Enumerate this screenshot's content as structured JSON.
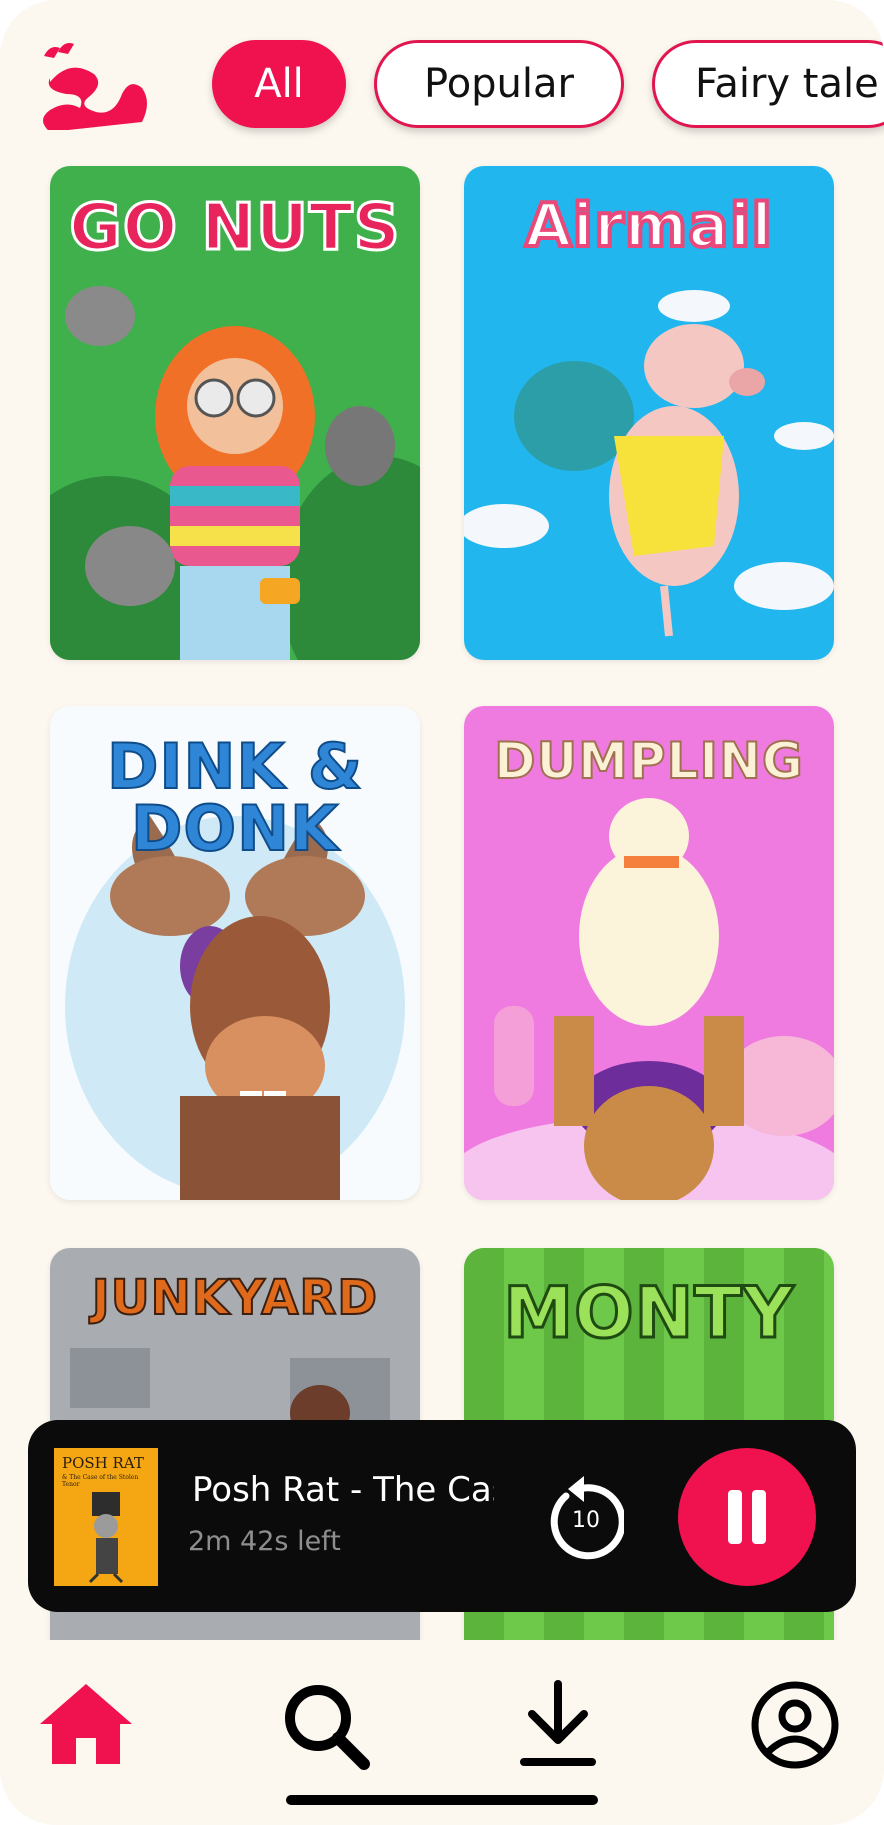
{
  "filters": [
    {
      "label": "All",
      "selected": true
    },
    {
      "label": "Popular",
      "selected": false
    },
    {
      "label": "Fairy tale",
      "selected": false
    }
  ],
  "stories": [
    {
      "title": "GO NUTS"
    },
    {
      "title": "Airmail"
    },
    {
      "title": "DINK & DONK"
    },
    {
      "title": "DUMPLING"
    },
    {
      "title": "JUNKYARD"
    },
    {
      "title": "MONTY"
    }
  ],
  "now_playing": {
    "title": "Posh Rat - The Case of the Stolen Tenor",
    "time_left": "2m 42s left",
    "cover_title": "POSH RAT",
    "cover_subtitle": "& The Case of the Stolen Tenor",
    "skip_back_seconds": "10"
  },
  "nav": [
    "home-icon",
    "search-icon",
    "download-icon",
    "profile-icon"
  ],
  "colors": {
    "accent": "#f0124f",
    "background": "#fcf7ef",
    "player": "#0b0b0b"
  }
}
